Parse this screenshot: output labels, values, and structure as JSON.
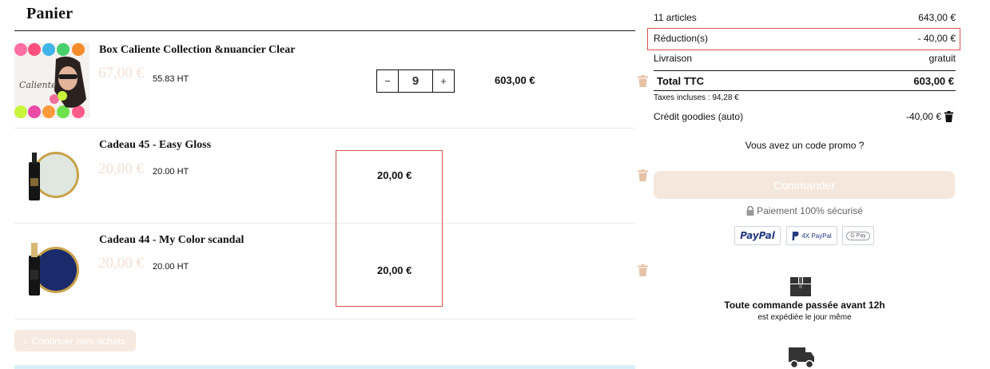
{
  "cart": {
    "title": "Panier",
    "items": [
      {
        "name": "Box Caliente Collection &nuancier Clear",
        "price": "67,00 €",
        "ht": "55.83 HT",
        "quantity": "9",
        "total": "603,00 €",
        "thumb_text": "Caliente"
      },
      {
        "name": "Cadeau 45 - Easy Gloss",
        "price": "20,00 €",
        "ht": "20.00 HT",
        "total": "20,00 €"
      },
      {
        "name": "Cadeau 44 - My Color scandal",
        "price": "20,00 €",
        "ht": "20.00 HT",
        "total": "20,00 €"
      }
    ],
    "qty_minus": "−",
    "qty_plus": "+",
    "continue_label": "Continuer mes achats"
  },
  "summary": {
    "articles_label": "11 articles",
    "articles_value": "643,00 €",
    "reduction_label": "Réduction(s)",
    "reduction_value": "- 40,00 €",
    "delivery_label": "Livraison",
    "delivery_value": "gratuit",
    "total_label": "Total TTC",
    "total_value": "603,00 €",
    "tax_note": "Taxes incluses : 94,28 €",
    "credit_label": "Crédit goodies (auto)",
    "credit_value": "-40,00 €",
    "promo_label": "Vous avez un code promo ?",
    "order_label": "Commander",
    "secure_label": "Paiement 100% sécurisé",
    "payments": {
      "paypal": "PayPal",
      "paypal4x": "4X PayPal",
      "gpay": "G Pay"
    },
    "shipping_title": "Toute commande passée avant 12h",
    "shipping_sub": "est expédiée le jour même"
  },
  "colors": {
    "accent_light": "#f5e7dc",
    "trash": "#e6c2a6",
    "highlight": "#d9534f",
    "paypal_dark": "#253b80",
    "paypal_light": "#179bd7"
  },
  "icons": [
    "trash-icon",
    "lock-icon",
    "box-icon",
    "truck-icon",
    "chevron-left-icon"
  ]
}
